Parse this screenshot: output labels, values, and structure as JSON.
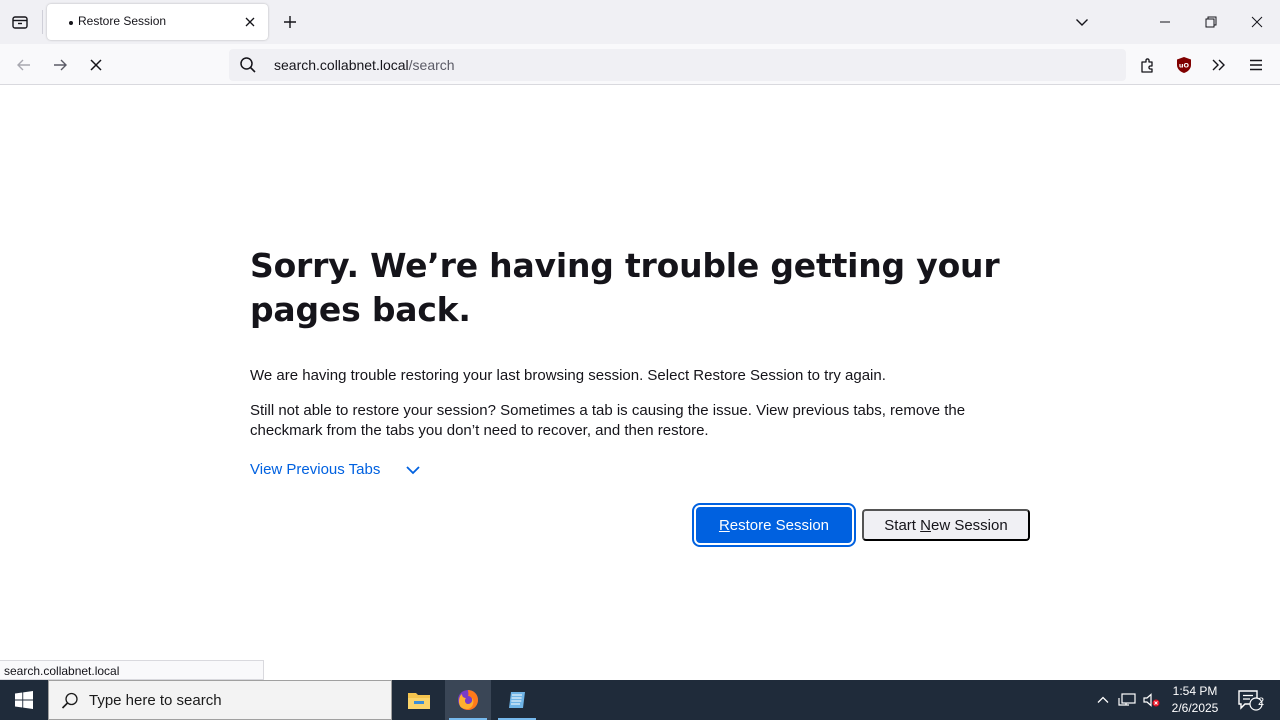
{
  "browser": {
    "tab": {
      "title": "Restore Session"
    },
    "url": {
      "host": "search.collabnet.local",
      "path": "/search"
    }
  },
  "content": {
    "heading": "Sorry. We’re having trouble getting your pages back.",
    "para1": "We are having trouble restoring your last browsing session. Select Restore Session to try again.",
    "para2": "Still not able to restore your session? Sometimes a tab is causing the issue. View previous tabs, remove the checkmark from the tabs you don’t need to recover, and then restore.",
    "view_previous_tabs": "View Previous Tabs",
    "restore_button": {
      "before": "",
      "access": "R",
      "after": "estore Session"
    },
    "new_session_button": {
      "before": "Start ",
      "access": "N",
      "after": "ew Session"
    }
  },
  "status_bar": {
    "link": "search.collabnet.local"
  },
  "taskbar": {
    "search_placeholder": "Type here to search",
    "time": "1:54 PM",
    "date": "2/6/2025",
    "notification_count": "2"
  },
  "colors": {
    "accent": "#0061e0",
    "taskbar": "#1f2b3a",
    "tabstrip": "#f0f0f4"
  },
  "icons": [
    "tab-list-icon",
    "close-icon",
    "plus-icon",
    "chevron-down-icon",
    "minimize-icon",
    "restore-icon",
    "back-arrow-icon",
    "forward-arrow-icon",
    "stop-icon",
    "search-icon",
    "extensions-icon",
    "ublock-icon",
    "overflow-icon",
    "menu-icon",
    "windows-icon",
    "file-explorer-icon",
    "firefox-icon",
    "notepad-icon",
    "chevron-up-icon",
    "network-icon",
    "volume-muted-icon",
    "notifications-icon"
  ]
}
